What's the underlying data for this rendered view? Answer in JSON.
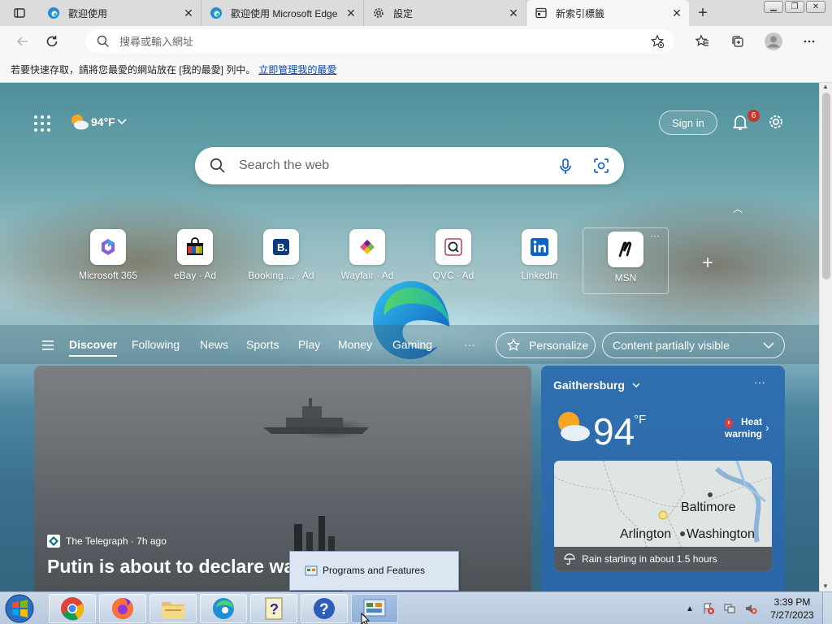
{
  "tabs": [
    {
      "label": "歡迎使用",
      "icon": "edge-icon"
    },
    {
      "label": "歡迎使用 Microsoft Edge",
      "icon": "edge-icon"
    },
    {
      "label": "設定",
      "icon": "gear-icon"
    },
    {
      "label": "新索引標籤",
      "icon": "newtab-icon",
      "active": true
    }
  ],
  "addressbar": {
    "placeholder": "搜尋或輸入網址"
  },
  "favorites_bar": {
    "text": "若要快速存取，請將您最愛的網站放在 [我的最愛] 列中。",
    "link": "立即管理我的最愛"
  },
  "newtab": {
    "weather_top": "94°F",
    "signin": "Sign in",
    "notifications": "6",
    "search_placeholder": "Search the web",
    "quick_links": [
      {
        "label": "Microsoft 365",
        "icon": "m365-icon"
      },
      {
        "label": "eBay · Ad",
        "icon": "ebay-icon"
      },
      {
        "label": "Booking.... · Ad",
        "icon": "booking-icon"
      },
      {
        "label": "Wayfair · Ad",
        "icon": "wayfair-icon"
      },
      {
        "label": "QVC · Ad",
        "icon": "qvc-icon"
      },
      {
        "label": "LinkedIn",
        "icon": "linkedin-icon"
      },
      {
        "label": "MSN",
        "icon": "msn-icon"
      }
    ],
    "feed_nav": [
      "Discover",
      "Following",
      "News",
      "Sports",
      "Play",
      "Money",
      "Gaming",
      "···"
    ],
    "feed_active": "Discover",
    "personalize": "Personalize",
    "content_visibility": "Content partially visible",
    "news": {
      "source": "The Telegraph · 7h ago",
      "title": "Putin is about to declare wa      ld"
    },
    "weather_card": {
      "location": "Gaithersburg",
      "temp": "94",
      "unit": "°F",
      "alert_line1": "Heat",
      "alert_line2": "warning",
      "map_labels": [
        "Baltimore",
        "Arlington",
        "Washington"
      ],
      "rain": "Rain starting in about 1.5 hours"
    }
  },
  "popup": {
    "label": "Programs and Features"
  },
  "taskbar": {
    "items": [
      "chrome-icon",
      "firefox-icon",
      "explorer-icon",
      "edge-icon",
      "help-file-icon",
      "help-icon",
      "control-panel-icon"
    ],
    "time": "3:39 PM",
    "date": "7/27/2023"
  },
  "colors": {
    "accent": "#0078d4",
    "tabstrip": "#dcdcdc",
    "weather_card": "#2b66a6",
    "taskbar": "#bfd0e3"
  }
}
